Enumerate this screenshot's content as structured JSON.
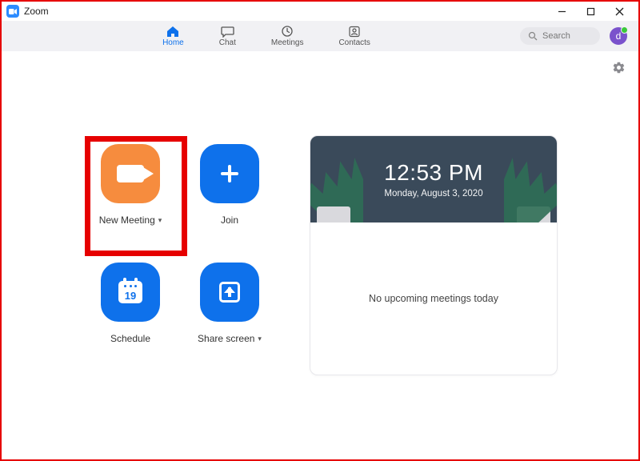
{
  "window": {
    "title": "Zoom"
  },
  "nav": {
    "tabs": [
      {
        "label": "Home",
        "active": true
      },
      {
        "label": "Chat",
        "active": false
      },
      {
        "label": "Meetings",
        "active": false
      },
      {
        "label": "Contacts",
        "active": false
      }
    ],
    "search_placeholder": "Search",
    "avatar_initial": "d"
  },
  "tiles": {
    "new_meeting": {
      "label": "New Meeting",
      "has_dropdown": true,
      "highlighted": true
    },
    "join": {
      "label": "Join",
      "has_dropdown": false
    },
    "schedule": {
      "label": "Schedule",
      "has_dropdown": false,
      "calendar_day": "19"
    },
    "share_screen": {
      "label": "Share screen",
      "has_dropdown": true
    }
  },
  "panel": {
    "time": "12:53 PM",
    "date": "Monday, August 3, 2020",
    "empty_message": "No upcoming meetings today"
  }
}
